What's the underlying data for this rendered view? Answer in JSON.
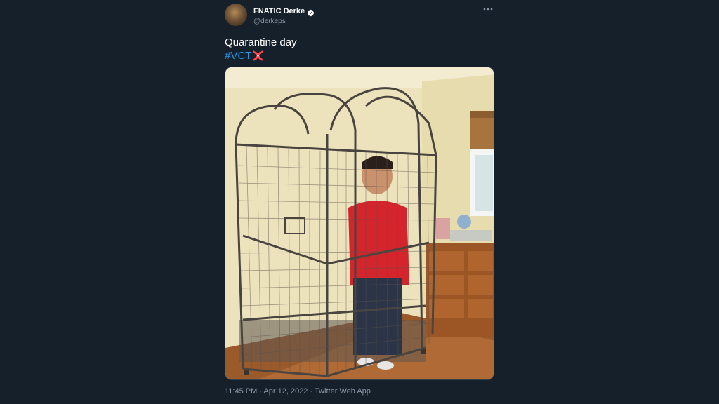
{
  "tweet": {
    "author": {
      "display_name": "FNATIC Derke",
      "handle": "@derkeps",
      "verified": true,
      "avatar_icon": "profile-photo"
    },
    "text_line1": "Quarantine day",
    "hashtag": "#VCT",
    "hashflag_icon": "vct-valorant-hashflag",
    "media_description_icon": "photo-man-in-bird-cage",
    "timestamp": "11:45 PM · Apr 12, 2022 · Twitter Web App",
    "more_icon": "ellipsis-icon"
  },
  "colors": {
    "background": "#15202b",
    "text_primary": "#ffffff",
    "text_secondary": "#8b98a5",
    "link": "#1d9bf0",
    "verified_badge": "#ffffff",
    "hashflag": "#ff4655"
  }
}
